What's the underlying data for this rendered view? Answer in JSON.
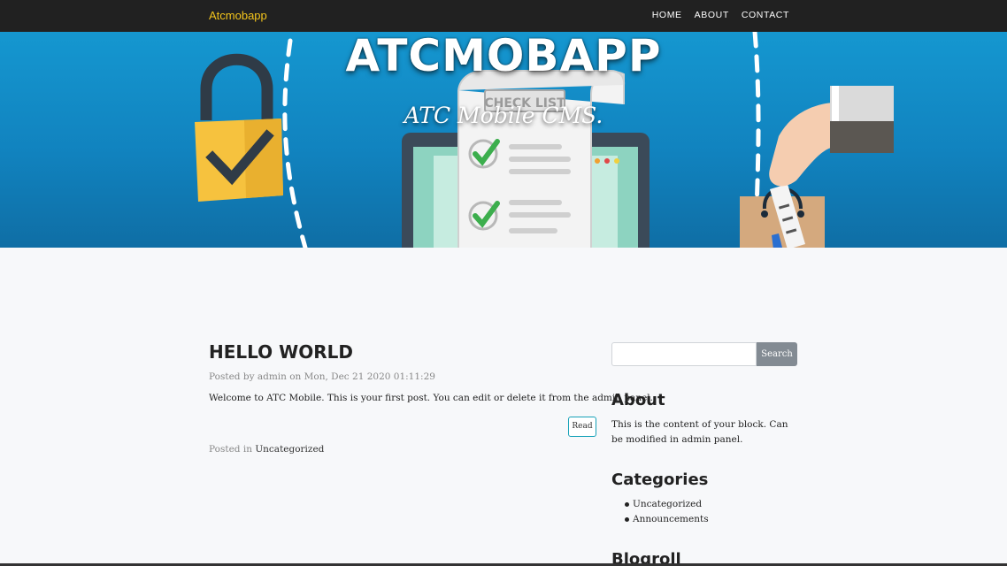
{
  "navbar": {
    "brand": "Atcmobapp",
    "links": [
      "HOME",
      "ABOUT",
      "CONTACT"
    ]
  },
  "hero": {
    "title": "ATCMOBAPP",
    "subtitle": "ATC Mobile CMS.",
    "checklist_label": "CHECK LIST"
  },
  "post": {
    "title": "HELLO WORLD",
    "meta": "Posted by admin on Mon, Dec 21 2020 01:11:29",
    "body": "Welcome to ATC Mobile. This is your first post. You can edit or delete it from the admin panel.",
    "read_label": "Read",
    "posted_in_label": "Posted in",
    "category": "Uncategorized"
  },
  "sidebar": {
    "search_placeholder": "",
    "search_button": "Search",
    "about_heading": "About",
    "about_text": "This is the content of your block. Can be modified in admin panel.",
    "categories_heading": "Categories",
    "categories": [
      "Uncategorized",
      "Announcements"
    ],
    "blogroll_heading": "Blogroll"
  },
  "colors": {
    "navbar_bg": "#212121",
    "brand": "#f4c51c",
    "hero_blue": "#1597d0",
    "read_border": "#17a2b8",
    "search_button_bg": "#838b93"
  },
  "icons": [
    "padlock-check-icon",
    "checklist-icon",
    "laptop-icon",
    "hand-bag-icon"
  ]
}
